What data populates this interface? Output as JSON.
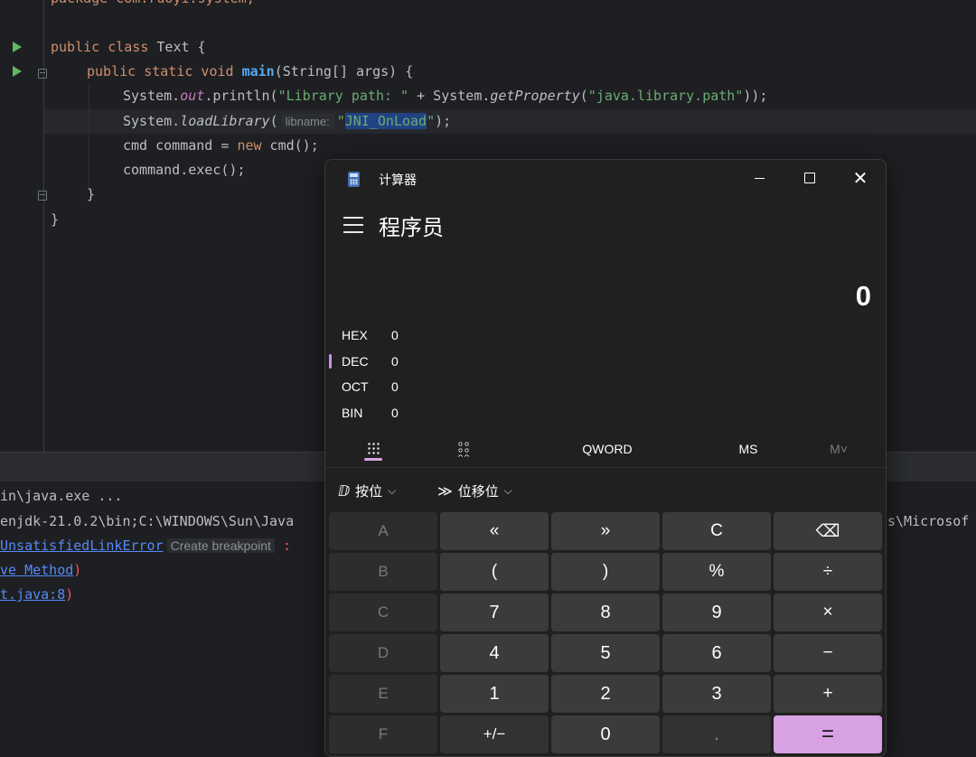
{
  "editor": {
    "partial_top": "package com.ruoyi.system;",
    "line_class": [
      "public",
      " ",
      "class",
      " Text {"
    ],
    "line_main": {
      "mods": "public static void ",
      "name": "main",
      "rest": "(String[] args) {"
    },
    "line_println": {
      "p1": "System.",
      "field": "out",
      "p2": ".println(",
      "s1": "\"Library path: \"",
      "p3": " + System.",
      "getprop": "getProperty",
      "p4": "(",
      "s2": "\"java.library.path\"",
      "p5": "));"
    },
    "line_load": {
      "p1": "System.",
      "fn": "loadLibrary",
      "p2": "(",
      "hint": "libname:",
      "q1": "\"",
      "selected": "JNI_OnLoad",
      "q2": "\"",
      "p3": ");"
    },
    "line_cmd": {
      "p1": "cmd command = ",
      "kw": "new",
      "p2": " cmd();"
    },
    "line_exec": "command.exec();",
    "close_inner": "}",
    "close_outer": "}"
  },
  "console": {
    "line1": "in\\java.exe ...",
    "line2_left": "enjdk-21.0.2\\bin;C:\\WINDOWS\\Sun\\Java",
    "line2_right": "s\\Microsof",
    "line3_err": "UnsatisfiedLinkError",
    "line3_hint": "Create breakpoint",
    "line3_tail": " :",
    "line4_link": "ve Method",
    "line4_tail": ")",
    "line5_link": "t.java:8",
    "line5_tail": ")"
  },
  "calculator": {
    "window_title": "计算器",
    "mode": "程序员",
    "display": "0",
    "radix": [
      {
        "label": "HEX",
        "value": "0"
      },
      {
        "label": "DEC",
        "value": "0"
      },
      {
        "label": "OCT",
        "value": "0"
      },
      {
        "label": "BIN",
        "value": "0"
      }
    ],
    "word_size": "QWORD",
    "ms": "MS",
    "m_dropdown": "M˅",
    "bitwise": "按位",
    "bitshift": "位移位",
    "keys": [
      "A",
      "«",
      "»",
      "C",
      "⌫",
      "B",
      "(",
      ")",
      "%",
      "÷",
      "C",
      "7",
      "8",
      "9",
      "×",
      "D",
      "4",
      "5",
      "6",
      "−",
      "E",
      "1",
      "2",
      "3",
      "+",
      "F",
      "+/−",
      "0",
      ".",
      "="
    ],
    "colors": {
      "accent": "#d8a1e3",
      "active_radix": "#c492e8"
    }
  }
}
